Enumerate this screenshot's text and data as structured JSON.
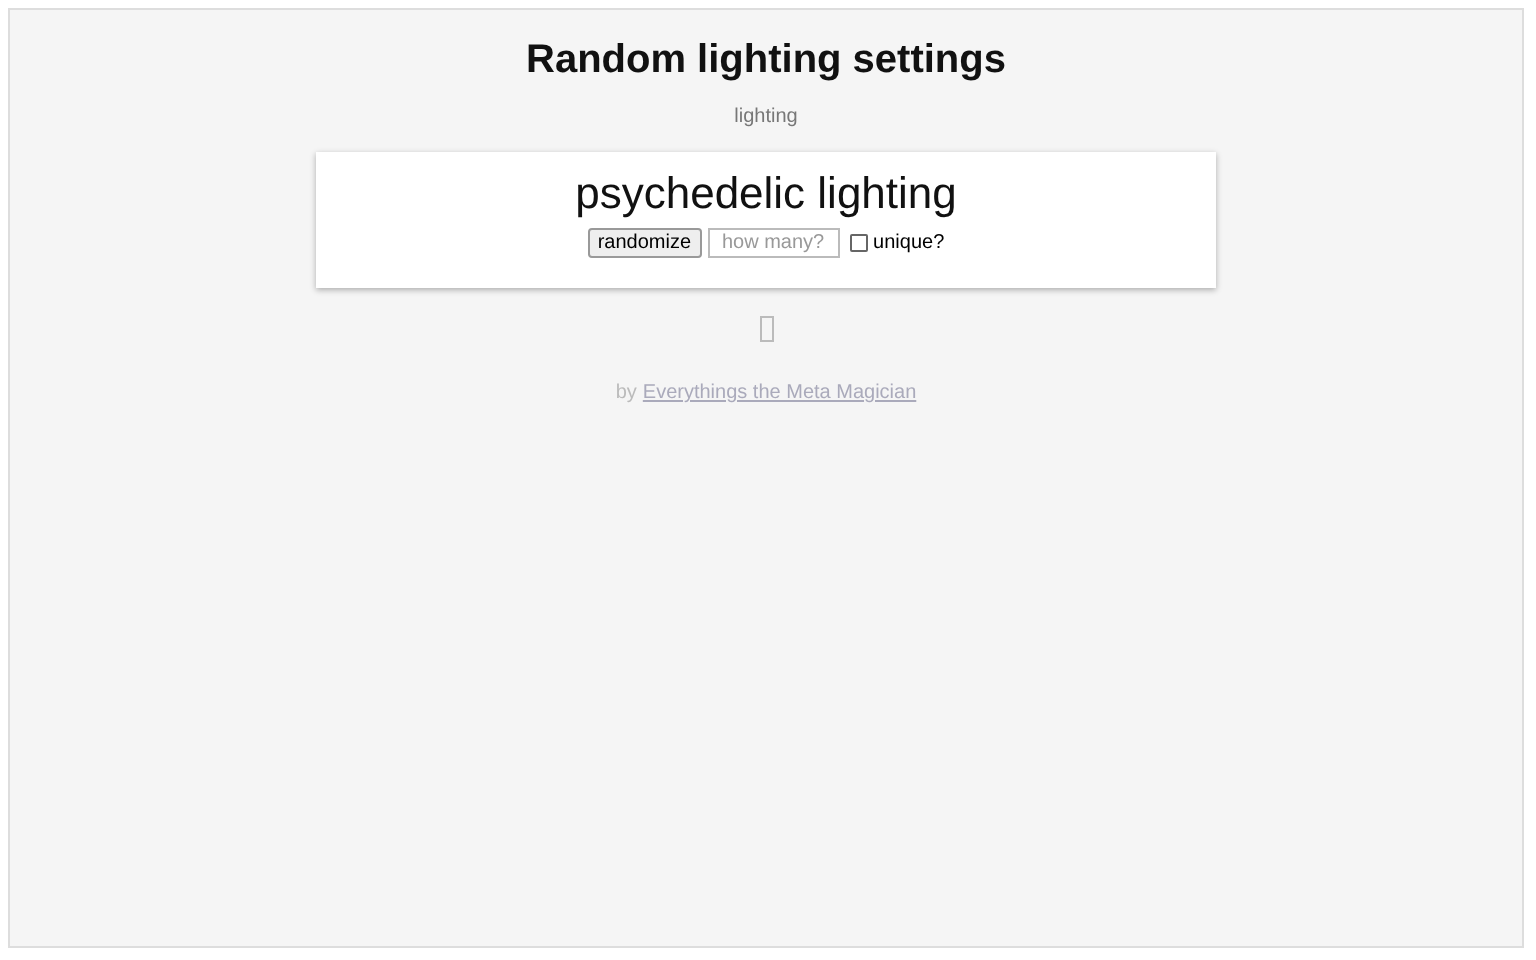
{
  "title": "Random lighting settings",
  "subtitle": "lighting",
  "result": "psychedelic lighting",
  "controls": {
    "button": "randomize",
    "count_placeholder": "how many?",
    "unique": {
      "label": "unique?",
      "checked": false
    }
  },
  "credit": {
    "prefix": "by",
    "link": "Everythings the Meta Magician"
  }
}
